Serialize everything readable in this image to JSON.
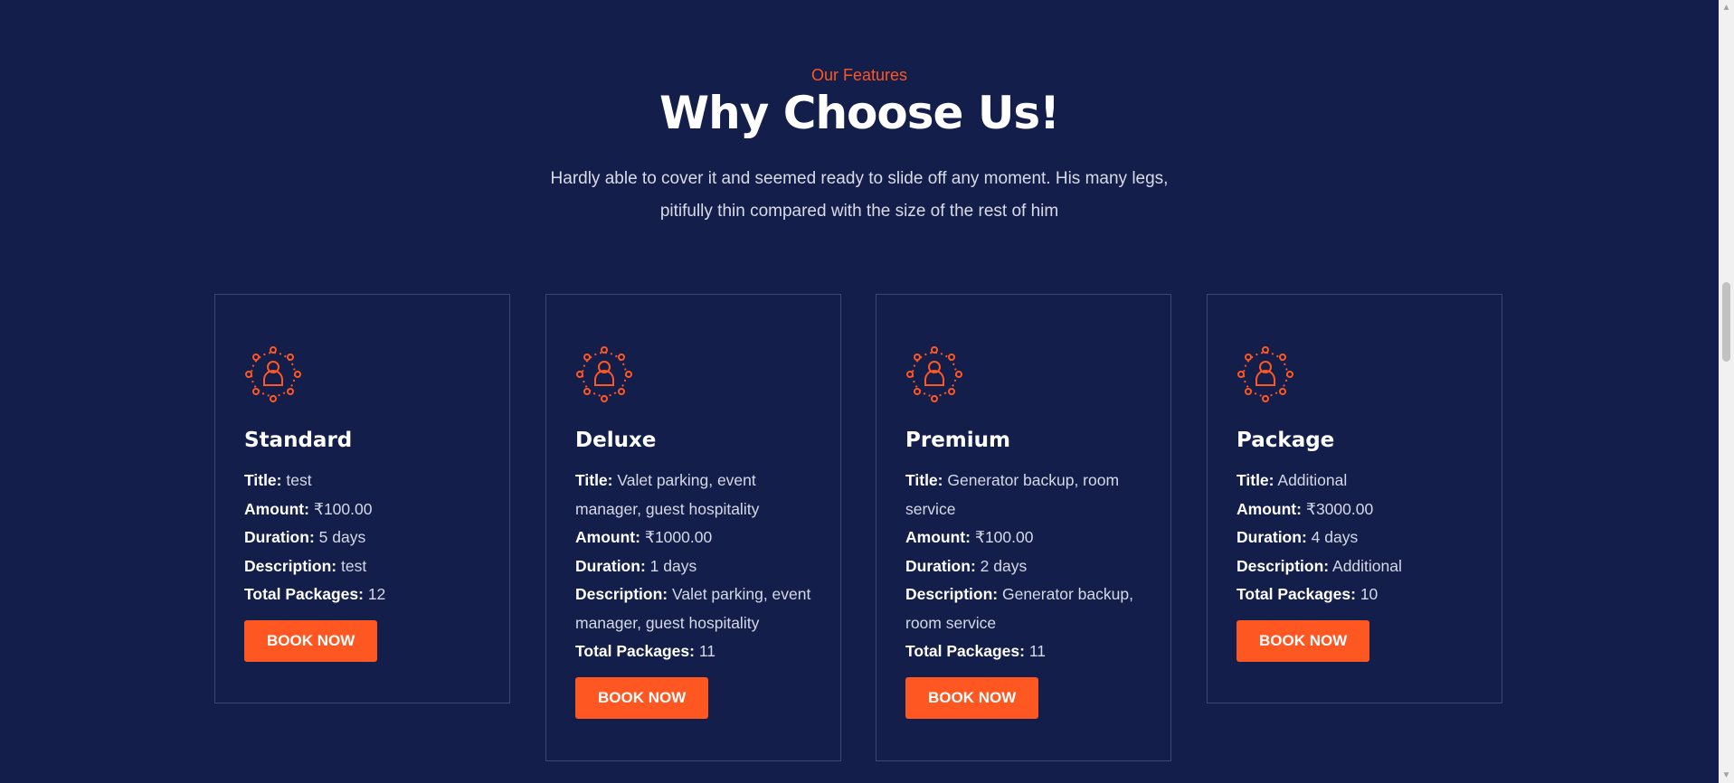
{
  "section": {
    "eyebrow": "Our Features",
    "title": "Why Choose Us!",
    "subtitle": "Hardly able to cover it and seemed ready to slide off any moment. His many legs, pitifully thin compared with the size of the rest of him"
  },
  "labels": {
    "title": "Title:",
    "amount": "Amount:",
    "duration": "Duration:",
    "description": "Description:",
    "total": "Total Packages:"
  },
  "cards": [
    {
      "name": "Standard",
      "title": "test",
      "amount": "₹100.00",
      "duration": "5 days",
      "description": "test",
      "total": "12",
      "button": "BOOK NOW"
    },
    {
      "name": "Deluxe",
      "title": "Valet parking, event manager, guest hospitality",
      "amount": "₹1000.00",
      "duration": "1 days",
      "description": "Valet parking, event manager, guest hospitality",
      "total": "11",
      "button": "BOOK NOW"
    },
    {
      "name": "Premium",
      "title": "Generator backup, room service",
      "amount": "₹100.00",
      "duration": "2 days",
      "description": "Generator backup, room service",
      "total": "11",
      "button": "BOOK NOW"
    },
    {
      "name": "Package",
      "title": "Additional",
      "amount": "₹3000.00",
      "duration": "4 days",
      "description": "Additional",
      "total": "10",
      "button": "BOOK NOW"
    }
  ],
  "icons": {
    "card": "network-user-icon",
    "scroll_up": "arrow-up-icon",
    "scroll_down": "arrow-down-icon"
  },
  "colors": {
    "background": "#131e4b",
    "accent": "#ff5722",
    "card_border": "#3d4773"
  }
}
